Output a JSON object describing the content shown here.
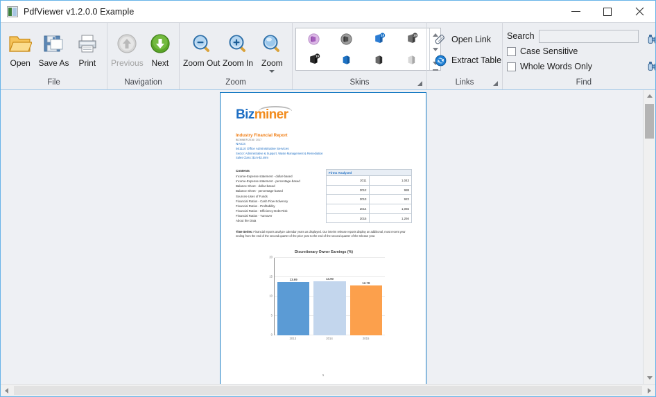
{
  "window": {
    "title": "PdfViewer v1.2.0.0 Example",
    "icon": "app-icon",
    "minimize_label": "–",
    "maximize_label": "□",
    "close_label": "✕"
  },
  "ribbon": {
    "groups": [
      {
        "name": "file",
        "label": "File",
        "buttons": [
          {
            "name": "open",
            "label": "Open",
            "icon": "open-folder-icon",
            "disabled": false
          },
          {
            "name": "save-as",
            "label": "Save As",
            "icon": "floppy-disk-icon",
            "disabled": false
          },
          {
            "name": "print",
            "label": "Print",
            "icon": "printer-icon",
            "disabled": false
          }
        ]
      },
      {
        "name": "navigation",
        "label": "Navigation",
        "buttons": [
          {
            "name": "previous",
            "label": "Previous",
            "icon": "arrow-up-circle-icon",
            "disabled": true
          },
          {
            "name": "next",
            "label": "Next",
            "icon": "arrow-down-circle-icon",
            "disabled": false
          }
        ]
      },
      {
        "name": "zoom",
        "label": "Zoom",
        "buttons": [
          {
            "name": "zoom-out",
            "label": "Zoom Out",
            "icon": "magnifier-minus-icon",
            "disabled": false
          },
          {
            "name": "zoom-in",
            "label": "Zoom In",
            "icon": "magnifier-plus-icon",
            "disabled": false
          },
          {
            "name": "zoom-menu",
            "label": "Zoom",
            "icon": "magnifier-icon",
            "disabled": false,
            "has_caret": true
          }
        ]
      }
    ],
    "skins": {
      "label": "Skins",
      "items": [
        {
          "name": "skin-office-2010-purple",
          "icon": "office-badge-icon",
          "color": "#c89fd4"
        },
        {
          "name": "skin-office-2010-black",
          "icon": "office-badge-icon",
          "color": "#6b6b6b"
        },
        {
          "name": "skin-office-2016-colorful",
          "icon": "office-2016-icon",
          "color": "#2b7cd3"
        },
        {
          "name": "skin-office-2016-dark-gray",
          "icon": "office-2016-icon",
          "color": "#3c3c3c"
        },
        {
          "name": "skin-office-2016-black",
          "icon": "office-2016-icon",
          "color": "#1a1a1a"
        },
        {
          "name": "skin-office-2013-blue",
          "icon": "office-2013-icon",
          "color": "#1d72c4"
        },
        {
          "name": "skin-office-2013-dark-gray",
          "icon": "office-2013-icon",
          "color": "#3c3c3c"
        },
        {
          "name": "skin-office-2013-light-gray",
          "icon": "office-2013-icon",
          "color": "#b7b7b7"
        }
      ],
      "scroll_up": "scroll-up",
      "scroll_down": "scroll-down",
      "scroll_more": "scroll-more"
    },
    "links": {
      "label": "Links",
      "buttons": [
        {
          "name": "open-link",
          "label": "Open Link",
          "icon": "paperclip-icon"
        },
        {
          "name": "extract-table",
          "label": "Extract Table",
          "icon": "extract-table-icon"
        }
      ]
    },
    "find": {
      "label": "Find",
      "search_label": "Search",
      "search_value": "",
      "search_placeholder": "",
      "checkboxes": [
        {
          "name": "case-sensitive",
          "label": "Case Sensitive",
          "checked": false
        },
        {
          "name": "whole-words-only",
          "label": "Whole Words Only",
          "checked": false
        }
      ],
      "icon_buttons": [
        {
          "name": "find-next",
          "icon": "binoculars-icon"
        },
        {
          "name": "find-all",
          "icon": "binoculars-icon"
        }
      ]
    }
  },
  "document": {
    "logo": {
      "biz": "Biz",
      "miner": "miner"
    },
    "report_title": "Industry Financial Report",
    "report_subtitle": "BIZMINER 2016 / 2017",
    "naics_line": "NAICS",
    "industry_line": "561110 Office Administrative Services",
    "sector_line": "Sector: Administrative & Support, Waste Management & Remediation",
    "sales_class_line": "Sales Class: $1m-$2.49m",
    "contents_heading": "Contents",
    "contents": [
      "Income-Expense statement - dollar-based",
      "Income-Expense statement - percentage-based",
      "Balance Sheet - dollar-based",
      "Balance Sheet - percentage-based",
      "Sources-Uses of Funds",
      "Financial Ratios - Cash Flow-Solvency",
      "Financial Ratios - Profitability",
      "Financial Ratios - Efficiency-Debt-Risk",
      "Financial Ratios - Turnover",
      "About the Data"
    ],
    "firms_table": {
      "header": "Firms Analyzed",
      "rows": [
        {
          "year": "2011",
          "count": "1,043"
        },
        {
          "year": "2012",
          "count": "988"
        },
        {
          "year": "2013",
          "count": "922"
        },
        {
          "year": "2014",
          "count": "1,065"
        },
        {
          "year": "2015",
          "count": "1,294"
        }
      ]
    },
    "time_series_note_label": "Time Series:",
    "time_series_note": "Financial reports analyze calendar years as displayed. Our interim release reports display an additional, most recent year ending from the end of the second quarter of the prior year to the end of the second quarter of the release year.",
    "page_number": "1"
  },
  "chart_data": {
    "type": "bar",
    "title": "Discretionary Owner Earnings (%)",
    "xlabel": "",
    "ylabel": "",
    "categories": [
      "2013",
      "2014",
      "2015"
    ],
    "values": [
      13.69,
      13.9,
      12.78
    ],
    "value_labels": [
      "13.69",
      "13.90",
      "12.78"
    ],
    "colors": [
      "#5b9bd5",
      "#c3d6ed",
      "#fca04c"
    ],
    "ylim": [
      0,
      20
    ],
    "yticks": [
      0,
      5,
      10,
      15,
      20
    ],
    "ytick_labels": [
      "0",
      "5",
      "10",
      "15",
      "20"
    ],
    "grid": true,
    "legend": "none"
  },
  "scrollbars": {
    "vertical": {
      "name": "vertical-scrollbar",
      "up": "scroll-up-arrow",
      "down": "scroll-down-arrow"
    },
    "horizontal": {
      "name": "horizontal-scrollbar",
      "left": "scroll-left-arrow",
      "right": "scroll-right-arrow"
    }
  }
}
